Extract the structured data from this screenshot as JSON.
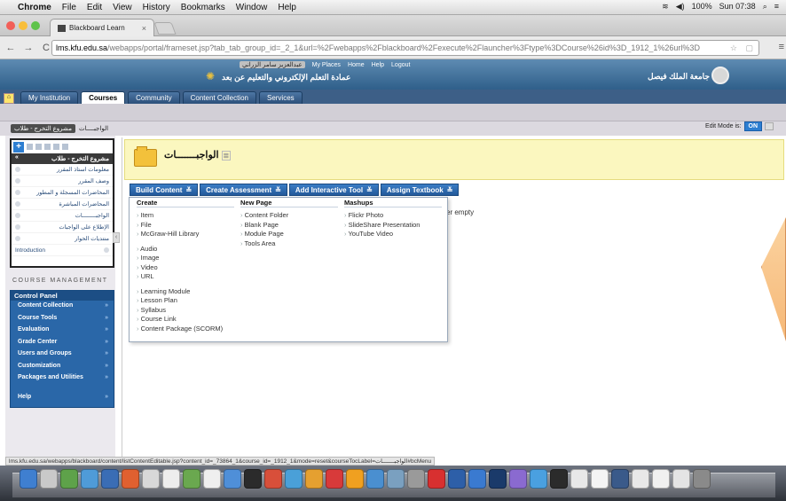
{
  "menubar": {
    "app": "Chrome",
    "items": [
      "File",
      "Edit",
      "View",
      "History",
      "Bookmarks",
      "Window",
      "Help"
    ],
    "battery": "100%",
    "clock": "Sun 07:38"
  },
  "browser": {
    "tab_title": "Blackboard Learn",
    "url_host": "lms.kfu.edu.sa",
    "url_path": "/webapps/portal/frameset.jsp?tab_tab_group_id=_2_1&url=%2Fwebapps%2Fblackboard%2Fexecute%2Flauncher%3Ftype%3DCourse%26id%3D_1912_1%26url%3D"
  },
  "header": {
    "user_name": "عبدالعزيز سامر الزراني",
    "links": [
      "My Places",
      "Home",
      "Help",
      "Logout"
    ],
    "deanship": "عمادة التعلم الإلكتروني والتعليم عن بعد",
    "university": "جامعة الملك فيصل"
  },
  "nav_tabs": [
    "My Institution",
    "Courses",
    "Community",
    "Content Collection",
    "Services"
  ],
  "breadcrumb": {
    "course": "مشروع التخرج - طلاب",
    "page": "الواجبــــات"
  },
  "edit_mode": {
    "label": "Edit Mode is:",
    "state": "ON"
  },
  "course_menu": {
    "title": "مشروع التخرج - طلاب",
    "items": [
      "معلومات استاذ المقرر",
      "وصف المقرر",
      "المحاضرات المسجلة و المطور",
      "المحاضرات المباشرة",
      "الواجبــــــــات",
      "الإطلاع على الواجبات",
      "منتديات الحوار",
      "Introduction"
    ]
  },
  "course_management": {
    "title": "COURSE MANAGEMENT",
    "panel_title": "Control Panel",
    "items": [
      "Content Collection",
      "Course Tools",
      "Evaluation",
      "Grade Center",
      "Users and Groups",
      "Customization",
      "Packages and Utilities",
      "Help"
    ]
  },
  "content": {
    "title": "الواجبـــــــات",
    "actions": [
      "Build Content",
      "Create Assessment",
      "Add Interactive Tool",
      "Assign Textbook"
    ],
    "empty_note": "er empty"
  },
  "build_menu": {
    "create": {
      "heading": "Create",
      "group1": [
        "Item",
        "File",
        "McGraw-Hill Library"
      ],
      "group2": [
        "Audio",
        "Image",
        "Video",
        "URL"
      ],
      "group3": [
        "Learning Module",
        "Lesson Plan",
        "Syllabus",
        "Course Link",
        "Content Package (SCORM)"
      ]
    },
    "new_page": {
      "heading": "New Page",
      "items": [
        "Content Folder",
        "Blank Page",
        "Module Page",
        "Tools Area"
      ]
    },
    "mashups": {
      "heading": "Mashups",
      "items": [
        "Flickr Photo",
        "SlideShare Presentation",
        "YouTube Video"
      ]
    }
  },
  "status_url": "lms.kfu.edu.sa/webapps/blackboard/content/listContentEditable.jsp?content_id=_73864_1&course_id=_1912_1&mode=reset&courseTocLabel=الواجبـــــــات#bcMenu",
  "colors": {
    "accent": "#2a67a8",
    "title_bg": "#fbf7bf",
    "nav": "#3d5f87"
  }
}
